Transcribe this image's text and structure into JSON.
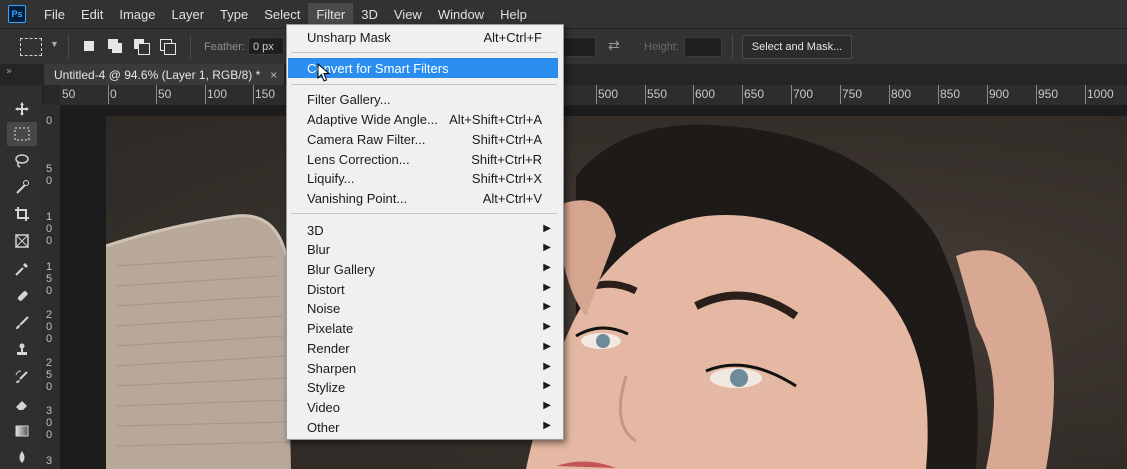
{
  "app": {
    "logo": "Ps"
  },
  "menubar": {
    "items": [
      "File",
      "Edit",
      "Image",
      "Layer",
      "Type",
      "Select",
      "Filter",
      "3D",
      "View",
      "Window",
      "Help"
    ],
    "active": "Filter"
  },
  "options": {
    "feather_label": "Feather:",
    "feather_value": "0 px",
    "height_label": "Height:",
    "select_mask_label": "Select and Mask..."
  },
  "tab": {
    "title": "Untitled-4 @ 94.6% (Layer 1, RGB/8) *",
    "close": "×"
  },
  "ruler": {
    "h_labels": [
      "50",
      "0",
      "50",
      "100",
      "150",
      "500",
      "550",
      "600",
      "650",
      "700",
      "750",
      "800",
      "850",
      "900",
      "950",
      "1000"
    ],
    "v_labels": [
      "0",
      "5 0",
      "1 0 0",
      "1 5 0",
      "2 0 0",
      "2 5 0",
      "3 0 0",
      "3"
    ]
  },
  "filter_menu": {
    "unsharp_mask": {
      "label": "Unsharp Mask",
      "shortcut": "Alt+Ctrl+F"
    },
    "convert_smart": {
      "label": "Convert for Smart Filters"
    },
    "filter_gallery": {
      "label": "Filter Gallery..."
    },
    "adaptive_wide": {
      "label": "Adaptive Wide Angle...",
      "shortcut": "Alt+Shift+Ctrl+A"
    },
    "camera_raw": {
      "label": "Camera Raw Filter...",
      "shortcut": "Shift+Ctrl+A"
    },
    "lens_correction": {
      "label": "Lens Correction...",
      "shortcut": "Shift+Ctrl+R"
    },
    "liquify": {
      "label": "Liquify...",
      "shortcut": "Shift+Ctrl+X"
    },
    "vanishing_point": {
      "label": "Vanishing Point...",
      "shortcut": "Alt+Ctrl+V"
    },
    "submenus": [
      "3D",
      "Blur",
      "Blur Gallery",
      "Distort",
      "Noise",
      "Pixelate",
      "Render",
      "Sharpen",
      "Stylize",
      "Video",
      "Other"
    ]
  },
  "colors": {
    "menu_highlight": "#2a8df0",
    "menu_bg": "#f0f0f0",
    "app_bg": "#282828"
  }
}
